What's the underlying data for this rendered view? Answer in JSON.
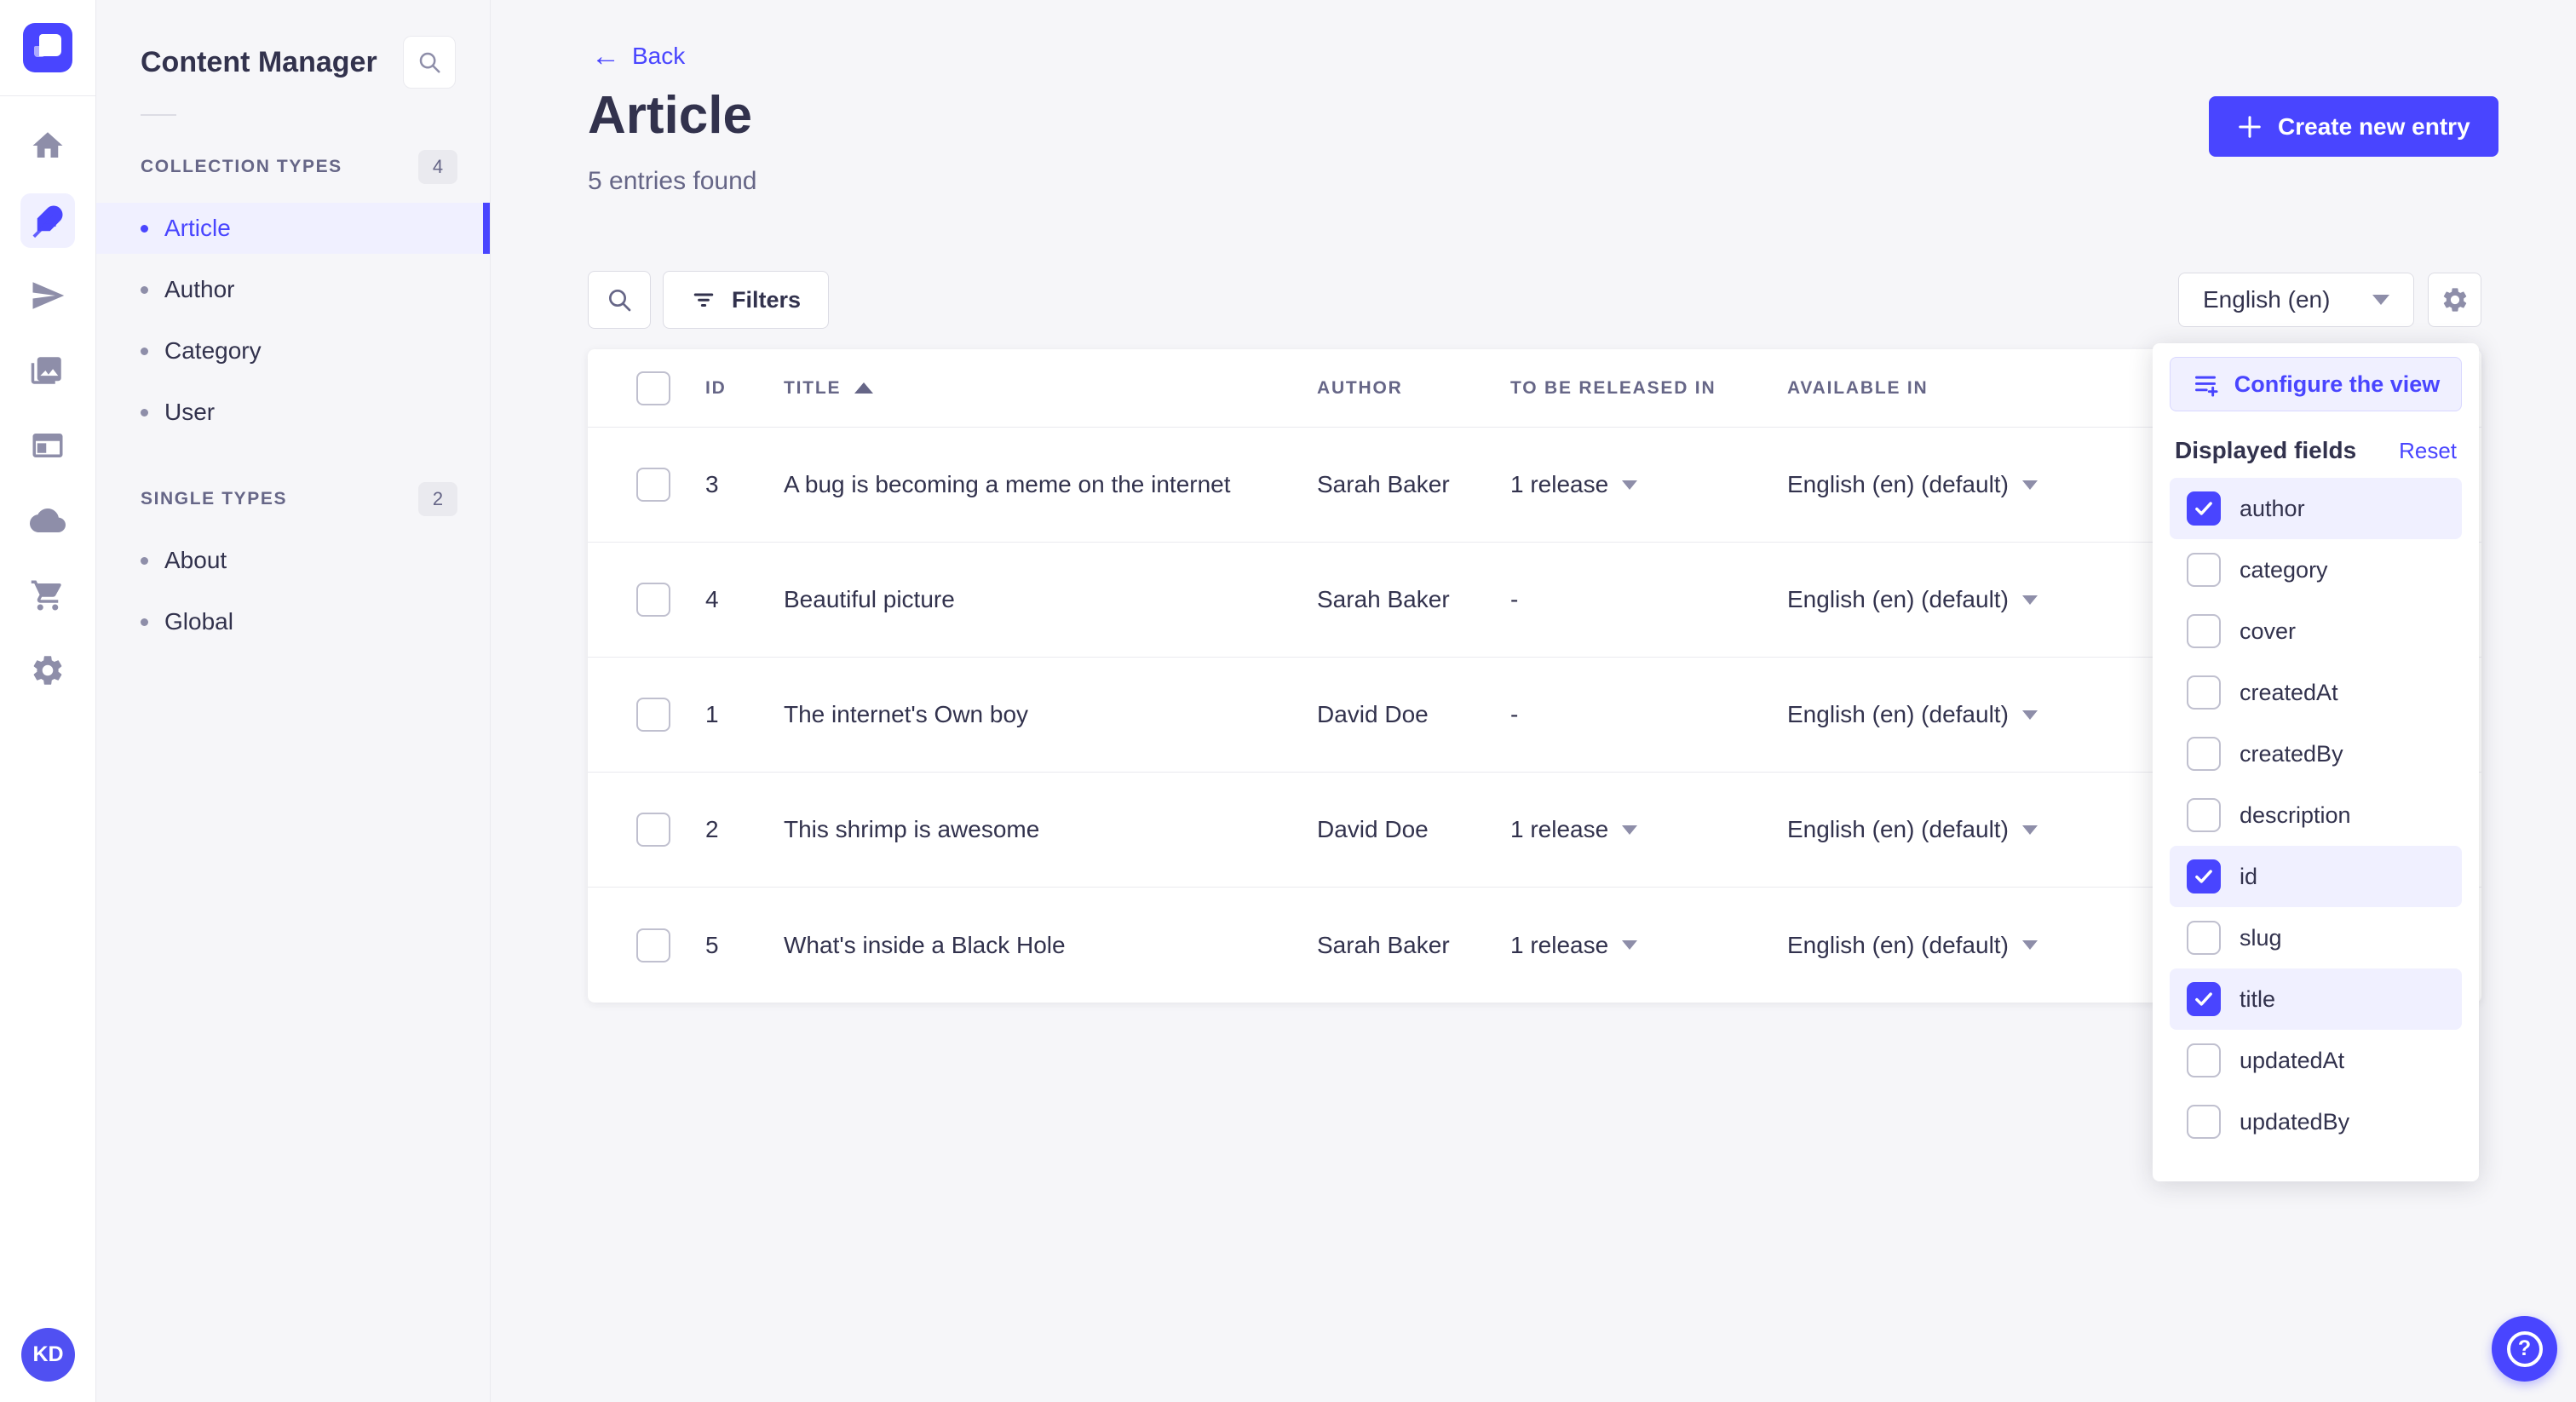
{
  "colors": {
    "accent": "#4945ff",
    "accent_soft": "#f0f0ff",
    "text": "#32324d",
    "text_muted": "#666687",
    "bg": "#f6f6f9"
  },
  "rail": {
    "icons": [
      "home-icon",
      "content-manager-feather-icon",
      "releases-plane-icon",
      "media-library-icon",
      "content-type-builder-icon",
      "cloud-icon",
      "marketplace-cart-icon",
      "settings-gear-icon"
    ],
    "active_icon_index": 1,
    "avatar_initials": "KD"
  },
  "sidebar": {
    "title": "Content Manager",
    "sections": [
      {
        "label": "COLLECTION TYPES",
        "count": "4",
        "items": [
          {
            "label": "Article",
            "active": true
          },
          {
            "label": "Author",
            "active": false
          },
          {
            "label": "Category",
            "active": false
          },
          {
            "label": "User",
            "active": false
          }
        ]
      },
      {
        "label": "SINGLE TYPES",
        "count": "2",
        "items": [
          {
            "label": "About",
            "active": false
          },
          {
            "label": "Global",
            "active": false
          }
        ]
      }
    ]
  },
  "header": {
    "back_label": "Back",
    "back_arrow": "←",
    "title": "Article",
    "subtitle": "5 entries found",
    "create_button_label": "Create new entry"
  },
  "toolbar": {
    "filters_label": "Filters",
    "locale_value": "English (en)"
  },
  "table": {
    "columns": {
      "id": "ID",
      "title": "TITLE",
      "author": "AUTHOR",
      "release": "TO BE RELEASED IN",
      "available": "AVAILABLE IN"
    },
    "sorted_column": "TITLE",
    "sort_direction": "asc",
    "rows": [
      {
        "id": "3",
        "title": "A bug is becoming a meme on the internet",
        "author": "Sarah Baker",
        "release": "1 release",
        "release_menu": true,
        "available": "English (en) (default)"
      },
      {
        "id": "4",
        "title": "Beautiful picture",
        "author": "Sarah Baker",
        "release": "-",
        "release_menu": false,
        "available": "English (en) (default)"
      },
      {
        "id": "1",
        "title": "The internet's Own boy",
        "author": "David Doe",
        "release": "-",
        "release_menu": false,
        "available": "English (en) (default)"
      },
      {
        "id": "2",
        "title": "This shrimp is awesome",
        "author": "David Doe",
        "release": "1 release",
        "release_menu": true,
        "available": "English (en) (default)"
      },
      {
        "id": "5",
        "title": "What's inside a Black Hole",
        "author": "Sarah Baker",
        "release": "1 release",
        "release_menu": true,
        "available": "English (en) (default)"
      }
    ]
  },
  "popover": {
    "configure_label": "Configure the view",
    "fields_title": "Displayed fields",
    "reset_label": "Reset",
    "fields": [
      {
        "label": "author",
        "checked": true
      },
      {
        "label": "category",
        "checked": false
      },
      {
        "label": "cover",
        "checked": false
      },
      {
        "label": "createdAt",
        "checked": false
      },
      {
        "label": "createdBy",
        "checked": false
      },
      {
        "label": "description",
        "checked": false
      },
      {
        "label": "id",
        "checked": true
      },
      {
        "label": "slug",
        "checked": false
      },
      {
        "label": "title",
        "checked": true
      },
      {
        "label": "updatedAt",
        "checked": false
      },
      {
        "label": "updatedBy",
        "checked": false
      }
    ]
  }
}
